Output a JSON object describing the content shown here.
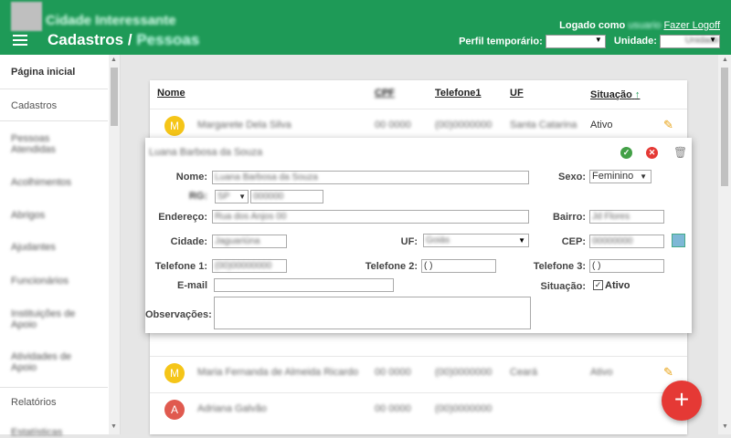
{
  "header": {
    "brand": "Cidade Interessante",
    "title": "Cadastros /",
    "title_blurred": "Pessoas",
    "logged_prefix": "Logado como",
    "logged_user": "usuario",
    "logoff": "Fazer Logoff",
    "perfil_label": "Perfil temporário:",
    "perfil_value": "",
    "unidade_label": "Unidade:",
    "unidade_value": "Unidade"
  },
  "sidebar": {
    "items": [
      "Página inicial",
      "Cadastros",
      "Pessoas Atendidas",
      "Acolhimentos",
      "Abrigos",
      "Ajudantes",
      "Funcionários",
      "Instituições de Apoio",
      "Atividades de Apoio",
      "Relatórios",
      "Estatísticas"
    ]
  },
  "table": {
    "headers": {
      "nome": "Nome",
      "col2": "CPF",
      "tel": "Telefone1",
      "uf": "UF",
      "situacao": "Situação"
    },
    "rows": [
      {
        "initial": "M",
        "color": "#f5c518",
        "nome": "Margarete Dela Silva",
        "col2": "00 0000",
        "tel": "(00)0000000",
        "uf": "Santa Catarina",
        "situacao": "Ativo"
      },
      {
        "initial": "M",
        "color": "#f5c518",
        "nome": "Maria Fernanda de Almeida Ricardo",
        "col2": "00 0000",
        "tel": "(00)0000000",
        "uf": "Ceará",
        "situacao": "Ativo"
      },
      {
        "initial": "A",
        "color": "#e05a4f",
        "nome": "Adriana Galvão",
        "col2": "00 0000",
        "tel": "(00)0000000",
        "uf": "",
        "situacao": ""
      }
    ]
  },
  "form": {
    "title": "Luana Barbosa da Souza",
    "nome_label": "Nome:",
    "nome_value": "Luana Barbosa da Souza",
    "sexo_label": "Sexo:",
    "sexo_value": "Feminino",
    "doc_label": "RG:",
    "doc_uf": "SP",
    "doc_value": "000000",
    "endereco_label": "Endereço:",
    "endereco_value": "Rua dos Anjos 00",
    "bairro_label": "Bairro:",
    "bairro_value": "Jd Flores",
    "cidade_label": "Cidade:",
    "cidade_value": "Jaguariúna",
    "uf_label": "UF:",
    "uf_value": "Goiás",
    "cep_label": "CEP:",
    "cep_value": "00000000",
    "tel1_label": "Telefone 1:",
    "tel1_value": "(00)00000000",
    "tel2_label": "Telefone 2:",
    "tel2_value": "(  )",
    "tel3_label": "Telefone 3:",
    "tel3_value": "(  )",
    "email_label": "E-mail",
    "email_value": "",
    "situacao_label": "Situação:",
    "situacao_value": "Ativo",
    "obs_label": "Observações:",
    "obs_value": ""
  },
  "fab": "+"
}
